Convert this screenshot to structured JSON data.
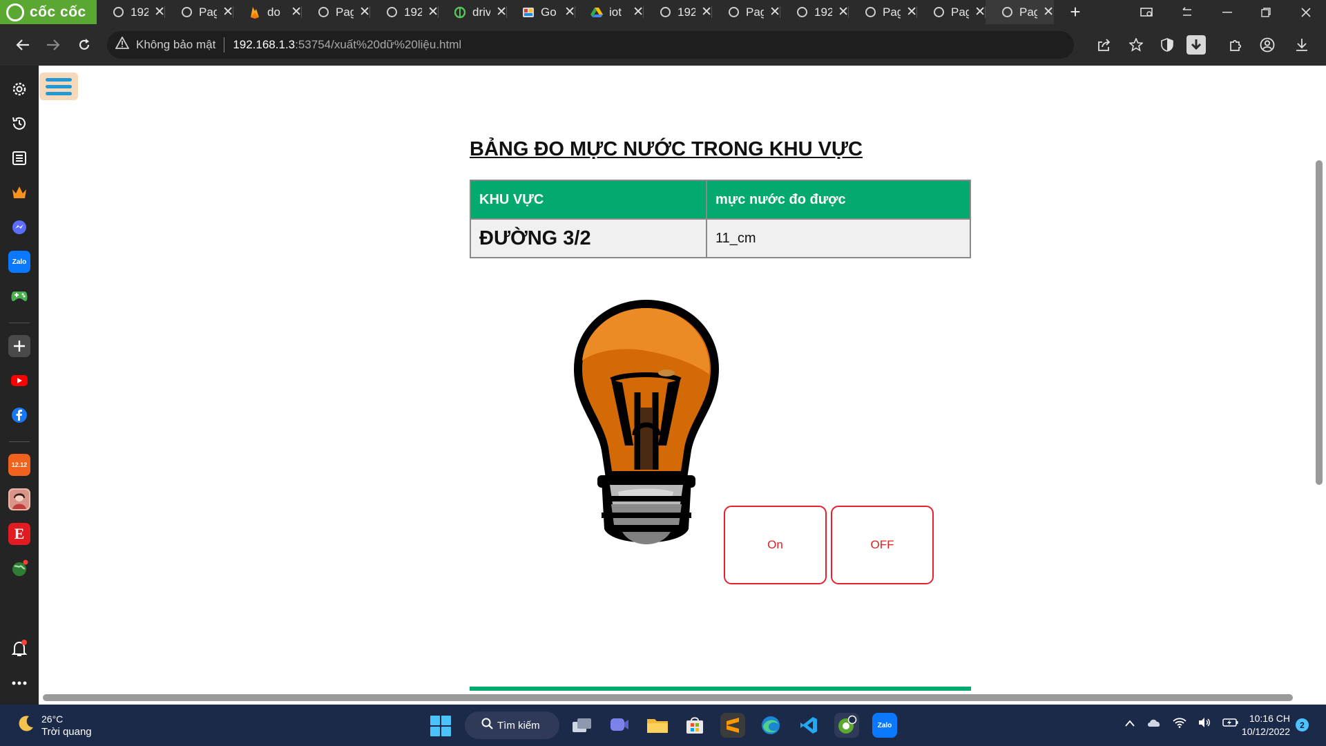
{
  "browser": {
    "brand": "cốc cốc",
    "tabs": [
      {
        "title": "192",
        "favicon": "globe-icon"
      },
      {
        "title": "Pag",
        "favicon": "globe-icon"
      },
      {
        "title": "do",
        "favicon": "firebase-icon"
      },
      {
        "title": "Pag",
        "favicon": "globe-icon"
      },
      {
        "title": "192",
        "favicon": "globe-icon"
      },
      {
        "title": "driv",
        "favicon": "drive-icon"
      },
      {
        "title": "Go",
        "favicon": "gallery-icon"
      },
      {
        "title": "iot",
        "favicon": "google-drive-icon"
      },
      {
        "title": "192",
        "favicon": "globe-icon"
      },
      {
        "title": "Pag",
        "favicon": "globe-icon"
      },
      {
        "title": "192",
        "favicon": "globe-icon"
      },
      {
        "title": "Pag",
        "favicon": "globe-icon"
      },
      {
        "title": "Pag",
        "favicon": "globe-icon"
      },
      {
        "title": "Pag",
        "favicon": "globe-icon",
        "active": true
      }
    ],
    "close_glyph": "✕",
    "new_tab_glyph": "+",
    "address": {
      "security_label": "Không bảo mật",
      "host": "192.168.1.3",
      "path": ":53754/xuất%20dữ%20liệu.html"
    }
  },
  "sidebar": {
    "icons": [
      "settings-icon",
      "history-icon",
      "reading-list-icon",
      "crown-icon",
      "messenger-icon",
      "zalo-icon",
      "gamepad-icon",
      "add-icon",
      "youtube-icon",
      "facebook-icon",
      "shopee-icon",
      "avatar-icon",
      "e-app-icon",
      "globe-game-icon",
      "notification-bell-icon",
      "more-icon"
    ]
  },
  "page": {
    "heading": "BẢNG ĐO MỰC NƯỚC TRONG KHU VỰC",
    "table": {
      "headers": [
        "KHU VỰC",
        "mực nước đo được"
      ],
      "rows": [
        {
          "area": "ĐƯỜNG 3/2",
          "level": "11_cm"
        }
      ]
    },
    "buttons": {
      "on_label": "On",
      "off_label": "OFF"
    },
    "colors": {
      "table_header": "#04aa6d",
      "button_border": "#e8202e",
      "bulb_glass": "#e0720f"
    }
  },
  "taskbar": {
    "weather": {
      "temp": "26°C",
      "condition": "Trời quang"
    },
    "search_label": "Tìm kiếm",
    "clock": {
      "time": "10:16 CH",
      "date": "10/12/2022"
    },
    "notification_count": "2"
  }
}
